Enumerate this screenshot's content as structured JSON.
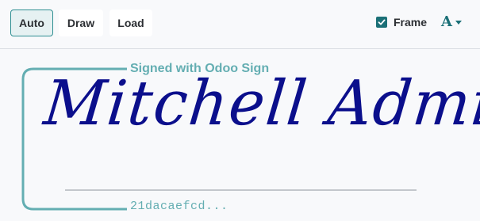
{
  "toolbar": {
    "modes": [
      {
        "label": "Auto",
        "active": true
      },
      {
        "label": "Draw",
        "active": false
      },
      {
        "label": "Load",
        "active": false
      }
    ],
    "frame_label": "Frame",
    "frame_checked": true,
    "font_icon": "A"
  },
  "signature": {
    "caption": "Signed with Odoo Sign",
    "name": "Mitchell Admin",
    "hash": "21dacaefcd...",
    "ink_color": "#0b0f8c",
    "frame_color": "#64aeb2"
  }
}
